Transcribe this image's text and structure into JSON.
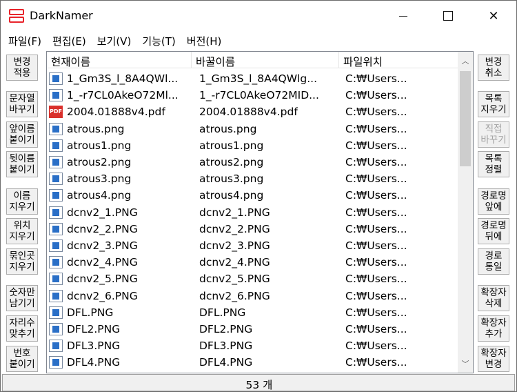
{
  "window": {
    "title": "DarkNamer",
    "accent": "#e8232a"
  },
  "menu": [
    "파일(F)",
    "편집(E)",
    "보기(V)",
    "기능(T)",
    "버전(H)"
  ],
  "left_buttons": [
    {
      "label": "변경\n적용",
      "enabled": true
    },
    {
      "label": "문자열\n바꾸기",
      "enabled": true
    },
    {
      "label": "앞이름\n붙이기",
      "enabled": true
    },
    {
      "label": "뒷이름\n붙이기",
      "enabled": true
    },
    {
      "label": "이름\n지우기",
      "enabled": true
    },
    {
      "label": "위치\n지우기",
      "enabled": true
    },
    {
      "label": "묶인곳\n지우기",
      "enabled": true
    },
    {
      "label": "숫자만\n남기기",
      "enabled": true
    },
    {
      "label": "자리수\n맞추기",
      "enabled": true
    },
    {
      "label": "번호\n붙이기",
      "enabled": true
    }
  ],
  "right_buttons": [
    {
      "label": "변경\n취소",
      "enabled": true
    },
    {
      "label": "목록\n지우기",
      "enabled": true
    },
    {
      "label": "직접\n바꾸기",
      "enabled": false
    },
    {
      "label": "목록\n정렬",
      "enabled": true
    },
    {
      "label": "경로명\n앞에",
      "enabled": true
    },
    {
      "label": "경로명\n뒤에",
      "enabled": true
    },
    {
      "label": "경로\n통일",
      "enabled": true
    },
    {
      "label": "확장자\n삭제",
      "enabled": true
    },
    {
      "label": "확장자\n추가",
      "enabled": true
    },
    {
      "label": "확장자\n변경",
      "enabled": true
    }
  ],
  "list": {
    "columns": [
      "현재이름",
      "바꿀이름",
      "파일위치"
    ],
    "rows": [
      {
        "current": "1_Gm3S_l_8A4QWl...",
        "new": "1_Gm3S_l_8A4QWlg...",
        "path": "C:₩Users...",
        "icon": "image-file-icon"
      },
      {
        "current": "1_-r7CL0AkeO72Ml...",
        "new": "1_-r7CL0AkeO72MID...",
        "path": "C:₩Users...",
        "icon": "image-file-icon"
      },
      {
        "current": "2004.01888v4.pdf",
        "new": "2004.01888v4.pdf",
        "path": "C:₩Users...",
        "icon": "pdf-file-icon"
      },
      {
        "current": "atrous.png",
        "new": "atrous.png",
        "path": "C:₩Users...",
        "icon": "image-file-icon"
      },
      {
        "current": "atrous1.png",
        "new": "atrous1.png",
        "path": "C:₩Users...",
        "icon": "image-file-icon"
      },
      {
        "current": "atrous2.png",
        "new": "atrous2.png",
        "path": "C:₩Users...",
        "icon": "image-file-icon"
      },
      {
        "current": "atrous3.png",
        "new": "atrous3.png",
        "path": "C:₩Users...",
        "icon": "image-file-icon"
      },
      {
        "current": "atrous4.png",
        "new": "atrous4.png",
        "path": "C:₩Users...",
        "icon": "image-file-icon"
      },
      {
        "current": "dcnv2_1.PNG",
        "new": "dcnv2_1.PNG",
        "path": "C:₩Users...",
        "icon": "image-file-icon"
      },
      {
        "current": "dcnv2_2.PNG",
        "new": "dcnv2_2.PNG",
        "path": "C:₩Users...",
        "icon": "image-file-icon"
      },
      {
        "current": "dcnv2_3.PNG",
        "new": "dcnv2_3.PNG",
        "path": "C:₩Users...",
        "icon": "image-file-icon"
      },
      {
        "current": "dcnv2_4.PNG",
        "new": "dcnv2_4.PNG",
        "path": "C:₩Users...",
        "icon": "image-file-icon"
      },
      {
        "current": "dcnv2_5.PNG",
        "new": "dcnv2_5.PNG",
        "path": "C:₩Users...",
        "icon": "image-file-icon"
      },
      {
        "current": "dcnv2_6.PNG",
        "new": "dcnv2_6.PNG",
        "path": "C:₩Users...",
        "icon": "image-file-icon"
      },
      {
        "current": "DFL.PNG",
        "new": "DFL.PNG",
        "path": "C:₩Users...",
        "icon": "image-file-icon"
      },
      {
        "current": "DFL2.PNG",
        "new": "DFL2.PNG",
        "path": "C:₩Users...",
        "icon": "image-file-icon"
      },
      {
        "current": "DFL3.PNG",
        "new": "DFL3.PNG",
        "path": "C:₩Users...",
        "icon": "image-file-icon"
      },
      {
        "current": "DFL4.PNG",
        "new": "DFL4.PNG",
        "path": "C:₩Users...",
        "icon": "image-file-icon"
      }
    ]
  },
  "status": {
    "count_text": "53 개"
  }
}
